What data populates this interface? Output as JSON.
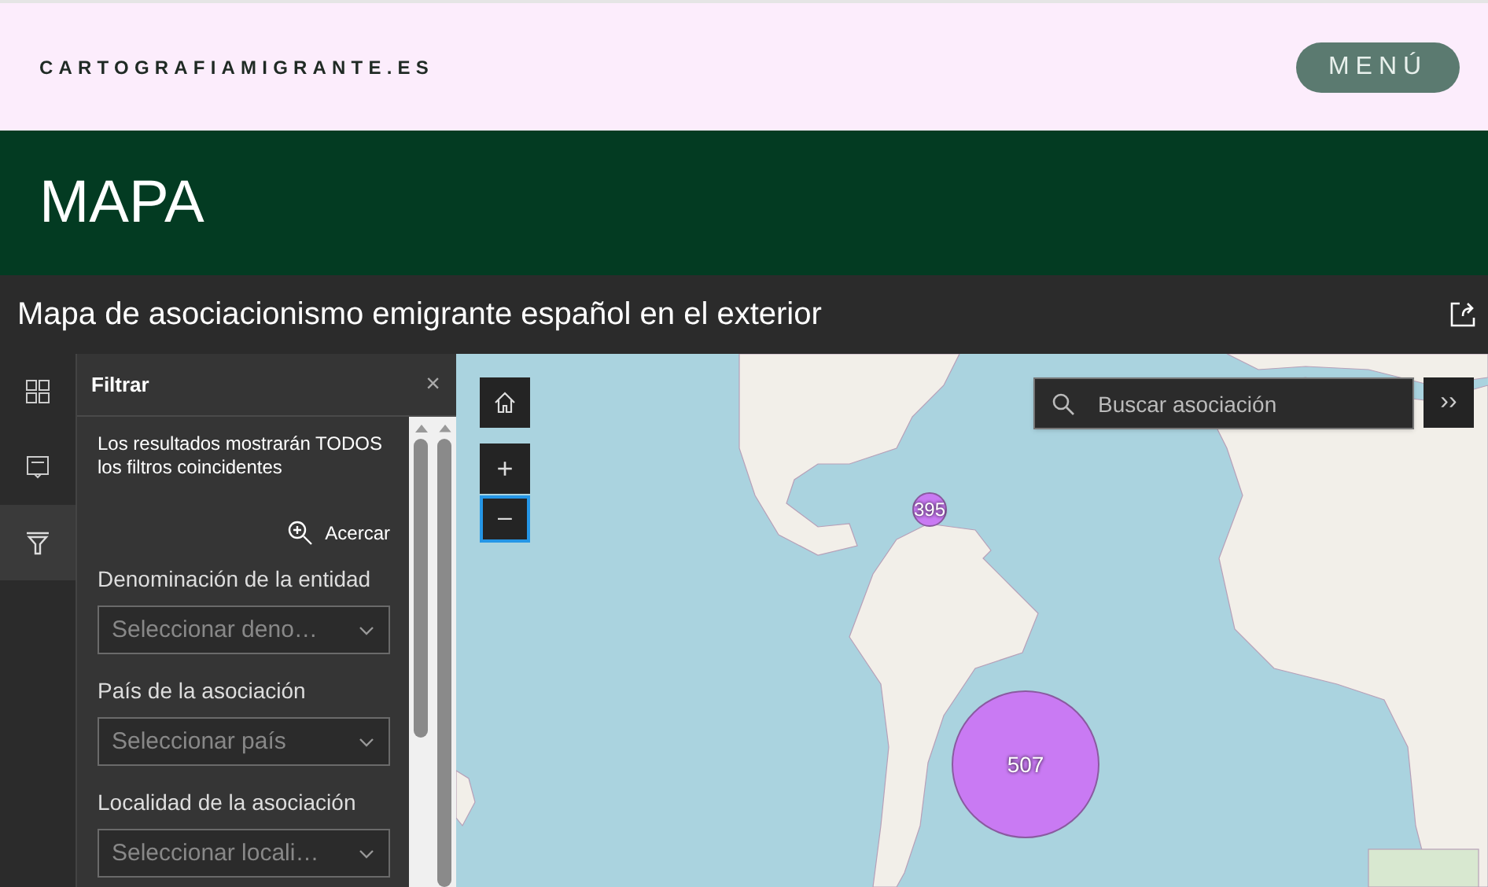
{
  "site_header": {
    "site_name": "CARTOGRAFIAMIGRANTE.ES",
    "menu_button": "MENÚ"
  },
  "page_heading": "MAPA",
  "app": {
    "title": "Mapa de asociacionismo emigrante español en el exterior"
  },
  "rail": [
    {
      "kind": "grid",
      "selected": false
    },
    {
      "kind": "legend",
      "selected": false
    },
    {
      "kind": "filter",
      "selected": true
    }
  ],
  "filter_panel": {
    "title": "Filtrar",
    "close": "×",
    "description": "Los resultados mostrarán TODOS los filtros coincidentes",
    "zoom_button": "Acercar",
    "fields": [
      {
        "label": "Denominación de la entidad",
        "placeholder": "Seleccionar deno…"
      },
      {
        "label": "País de la asociación",
        "placeholder": "Seleccionar país"
      },
      {
        "label": "Localidad de la asociación",
        "placeholder": "Seleccionar locali…"
      }
    ]
  },
  "map": {
    "search": {
      "placeholder": "Buscar asociación"
    },
    "expand": "››",
    "zoom_in": "+",
    "zoom_out": "–",
    "clusters": [
      {
        "label": "395"
      },
      {
        "label": "507"
      }
    ]
  }
}
